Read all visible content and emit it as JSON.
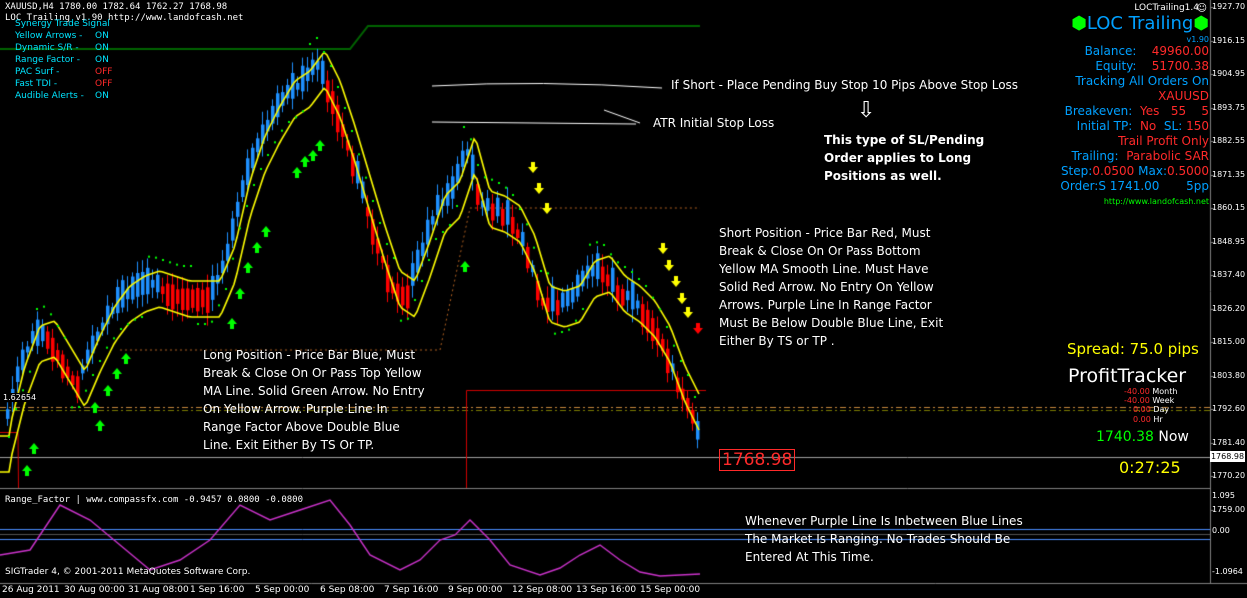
{
  "window": {
    "header": "XAUUSD,H4  1780.00 1782.64 1762.27 1768.98",
    "header2": "LOC Trailing v1.90 http://www.landofcash.net",
    "corner_label": "LOCTrailing1.4",
    "indicator_header": "Range_Factor | www.compassfx.com   -0.9457 0.0800 -0.0800",
    "copyright": "SIGTrader 4, © 2001-2011 MetaQuotes Software Corp.",
    "left_level_label": "1.62654",
    "current_price_box": "1768.98",
    "price_tag": "1768.98"
  },
  "status_panel": {
    "title": "Synergy Trade Signal",
    "items": [
      {
        "label": "Yellow Arrows -",
        "value": "ON",
        "state": "on"
      },
      {
        "label": "Dynamic S/R -",
        "value": "ON",
        "state": "on"
      },
      {
        "label": "Range Factor -",
        "value": "ON",
        "state": "on"
      },
      {
        "label": "PAC Surf -",
        "value": "OFF",
        "state": "off"
      },
      {
        "label": "Fast TDI -",
        "value": "OFF",
        "state": "off"
      },
      {
        "label": "Audible Alerts -",
        "value": "ON",
        "state": "on"
      }
    ]
  },
  "loc_panel": {
    "title": "LOC Trailing",
    "version": "v1.90",
    "balance_label": "Balance:",
    "balance": "49960.00",
    "equity_label": "Equity:",
    "equity": "51700.38",
    "tracking": "Tracking All Orders On",
    "symbol": "XAUUSD",
    "breakeven_label": "Breakeven:",
    "breakeven_state": "Yes",
    "breakeven_a": "55",
    "breakeven_b": "5",
    "initial_label": "Initial TP:",
    "initial_tp": "No",
    "sl_label": "SL:",
    "sl": "150",
    "trail_profit": "Trail Profit Only",
    "trailing_label": "Trailing:",
    "trailing": "Parabolic SAR",
    "step_label": "Step:",
    "step": "0.0500",
    "max_label": "Max:",
    "max": "0.5000",
    "order_label": "Order:S",
    "order_price": "1741.00",
    "order_pp": "5pp",
    "url": "http://www.landofcash.net"
  },
  "spread": "Spread: 75.0 pips",
  "profit_tracker": {
    "title": "ProfitTracker",
    "rows": [
      {
        "value": "-40.00",
        "period": "Month"
      },
      {
        "value": "-40.00",
        "period": "Week"
      },
      {
        "value": "0.00",
        "period": "Day"
      },
      {
        "value": "0.00",
        "period": "Hr"
      }
    ],
    "now_value": "1740.38",
    "now_label": "Now",
    "timer": "0:27:25"
  },
  "annotations": {
    "short_pending": "If Short - Place Pending  Buy Stop 10 Pips Above Stop Loss",
    "atr": "ATR Initial Stop Loss",
    "applies": "This type of SL/Pending Order applies to Long Positions as well.",
    "short_position": "Short Position - Price Bar Red, Must Break & Close On Or Pass Bottom Yellow MA Smooth Line. Must Have Solid Red Arrow. No Entry On Yellow Arrows. Purple Line In Range Factor Must Be Below Double Blue Line, Exit Either By TS or TP .",
    "long_position": "Long Position - Price Bar Blue, Must Break & Close On Or Pass Top Yellow MA Line. Solid Green Arrow. No Entry On Yellow Arrow. Purple Line In Range Factor Above Double Blue Line. Exit Either By TS Or TP.",
    "ranging": "Whenever Purple Line Is Inbetween Blue Lines The Market Is Ranging. No Trades Should Be Entered At This Time."
  },
  "colors": {
    "bull": "#1e90ff",
    "bear": "#ff0000",
    "ma": "#ffff00",
    "sar": "#00ff00",
    "range_line": "#cc33cc",
    "band": "#4a8cff",
    "accent": "#00ff00"
  },
  "chart_data": {
    "type": "candlestick",
    "y_ticks": [
      "1927.70",
      "1916.15",
      "1904.95",
      "1893.75",
      "1882.55",
      "1871.35",
      "1860.15",
      "1848.95",
      "1837.40",
      "1826.20",
      "1815.00",
      "1803.80",
      "1792.60",
      "1781.40",
      "1770.20",
      "1759.00"
    ],
    "ind_ticks": [
      "1.095",
      "0.00",
      "-1.0964"
    ],
    "x_labels": [
      "26 Aug 2011",
      "30 Aug 00:00",
      "31 Aug 08:00",
      "1 Sep 16:00",
      "5 Sep 00:00",
      "6 Sep 08:00",
      "7 Sep 16:00",
      "9 Sep 00:00",
      "12 Sep 08:00",
      "13 Sep 16:00",
      "15 Sep 00:00"
    ]
  }
}
